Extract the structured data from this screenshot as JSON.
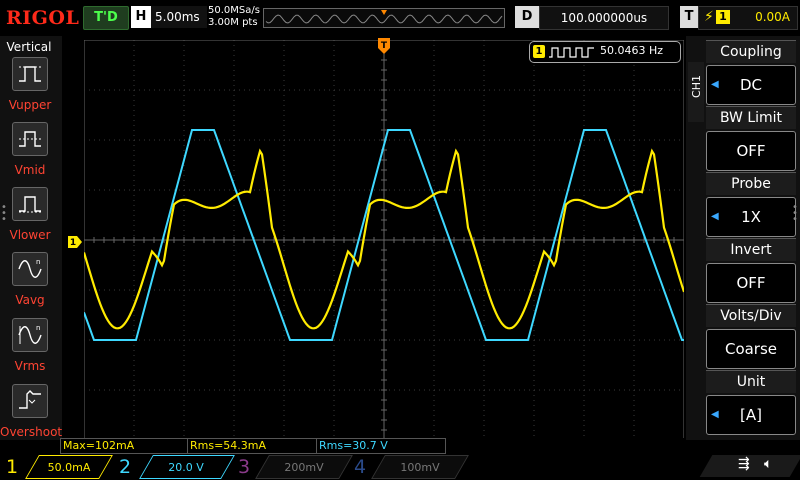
{
  "brand": "RIGOL",
  "trigger_status": "T'D",
  "horizontal": {
    "label": "H",
    "timebase": "5.00ms",
    "sample_rate": "50.0MSa/s",
    "memory_depth": "3.00M pts"
  },
  "delay": {
    "label": "D",
    "value": "100.000000us"
  },
  "trigger": {
    "label": "T",
    "edge_icon": "rising-edge-icon",
    "source": "1",
    "level": "0.00A"
  },
  "left_menu": {
    "title": "Vertical",
    "items": [
      {
        "label": "Vupper",
        "icon": "vupper-icon"
      },
      {
        "label": "Vmid",
        "icon": "vmid-icon"
      },
      {
        "label": "Vlower",
        "icon": "vlower-icon"
      },
      {
        "label": "Vavg",
        "icon": "vavg-icon"
      },
      {
        "label": "Vrms",
        "icon": "vrms-icon"
      },
      {
        "label": "Overshoot",
        "icon": "overshoot-icon"
      }
    ]
  },
  "frequency_counter": {
    "channel": "1",
    "value": "50.0463 Hz"
  },
  "channel_tab": "CH1",
  "right_menu": [
    {
      "title": "Coupling",
      "value": "DC",
      "has_arrow": true
    },
    {
      "title": "BW Limit",
      "value": "OFF",
      "has_arrow": false
    },
    {
      "title": "Probe",
      "value": "1X",
      "has_arrow": true
    },
    {
      "title": "Invert",
      "value": "OFF",
      "has_arrow": false
    },
    {
      "title": "Volts/Div",
      "value": "Coarse",
      "has_arrow": false
    },
    {
      "title": "Unit",
      "value": "[A]",
      "has_arrow": true
    }
  ],
  "measurements": [
    {
      "text": "Max=102mA",
      "color": "#ffeb00"
    },
    {
      "text": "Rms=54.3mA",
      "color": "#ffeb00"
    },
    {
      "text": "Rms=30.7 V",
      "color": "#3ed8ff"
    }
  ],
  "channels": [
    {
      "number": "1",
      "scale": "50.0mA",
      "color": "#ffeb00",
      "active": true
    },
    {
      "number": "2",
      "scale": "20.0 V",
      "color": "#3ed8ff",
      "active": true
    },
    {
      "number": "3",
      "scale": "200mV",
      "color": "#c83cc8",
      "active": false
    },
    {
      "number": "4",
      "scale": "100mV",
      "color": "#2a66ff",
      "active": false
    }
  ],
  "markers": {
    "trigger_pos": "T",
    "ch1_ground": "1"
  },
  "status_icons": [
    "usb-icon",
    "mute-icon"
  ],
  "colors": {
    "ch1": "#ffeb00",
    "ch2": "#3ed8ff",
    "trigger": "#ff8800",
    "grid": "#555555"
  }
}
